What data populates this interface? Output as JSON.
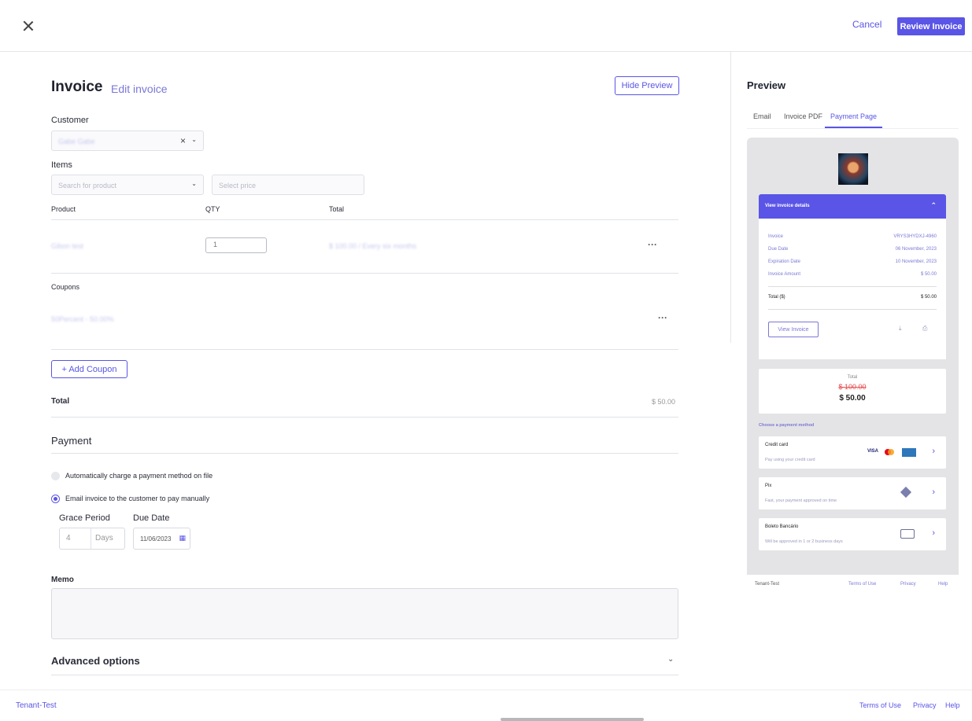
{
  "topbar": {
    "cancel_label": "Cancel",
    "review_label": "Review Invoice"
  },
  "editor": {
    "title": "Invoice",
    "subtitle": "Edit invoice",
    "hide_preview_label": "Hide Preview",
    "customer_label": "Customer",
    "customer_value": "Gabe Gabe",
    "items_label": "Items",
    "product_placeholder": "Search for product",
    "price_placeholder": "Select price",
    "columns": [
      "Product",
      "QTY",
      "Total"
    ],
    "row": {
      "product": "Gibon test",
      "qty": "1",
      "total": "$ 100.00 / Every six months"
    },
    "coupons_label": "Coupons",
    "coupon_value": "50Percent - 50.00%",
    "add_coupon_label": "Add Coupon",
    "total_label": "Total",
    "total_value": "$ 50.00",
    "payment_heading": "Payment",
    "auto_charge_label": "Automatically charge a payment method on file",
    "email_invoice_label": "Email invoice to the customer to pay manually",
    "grace_label": "Grace Period",
    "due_label": "Due Date",
    "grace_value": "4",
    "grace_unit": "Days",
    "due_value": "11/06/2023",
    "memo_label": "Memo",
    "advanced_label": "Advanced options"
  },
  "preview": {
    "heading": "Preview",
    "tabs": [
      "Email",
      "Invoice PDF",
      "Payment Page"
    ],
    "active_tab": "Payment Page",
    "view_details_label": "View invoice details",
    "details": [
      {
        "k": "Invoice",
        "v": "VRYS3HYDXJ-4960"
      },
      {
        "k": "Due Date",
        "v": "06 November, 2023"
      },
      {
        "k": "Expiration Date",
        "v": "10 November, 2023"
      },
      {
        "k": "Invoice Amount",
        "v": "$ 50.00"
      }
    ],
    "total_key": "Total ($)",
    "total_val": "$ 50.00",
    "view_invoice_label": "View Invoice",
    "summary_label": "Total",
    "summary_old": "$ 100.00",
    "summary_new": "$ 50.00",
    "choose_label": "Choose a payment method",
    "methods": [
      {
        "title": "Credit card",
        "sub": "Pay using your credit card"
      },
      {
        "title": "Pix",
        "sub": "Fast, your payment approved on time"
      },
      {
        "title": "Boleto Bancário",
        "sub": "Will be approved in 1 or 2 business days"
      }
    ],
    "visa_label": "VISA",
    "footer": {
      "tenant": "Tenant-Test",
      "terms": "Terms of Use",
      "privacy": "Privacy",
      "help": "Help"
    }
  },
  "footer": {
    "tenant": "Tenant-Test",
    "terms": "Terms of Use",
    "privacy": "Privacy",
    "help": "Help"
  },
  "colors": {
    "accent": "#5a55e6",
    "strike": "#e5484d"
  }
}
